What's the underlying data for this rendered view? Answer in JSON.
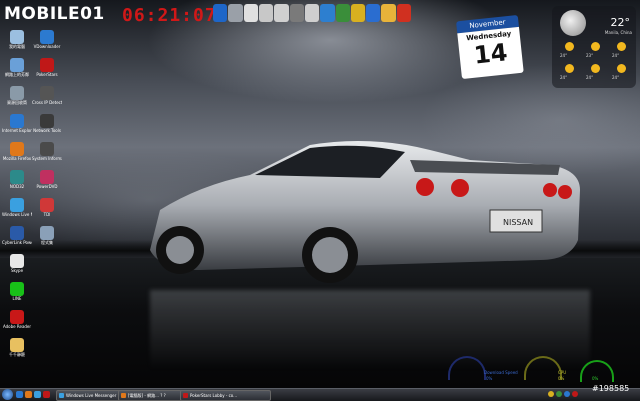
{
  "topbar": {
    "logo_text": "MOBILE01",
    "clock_time": "06:21:07",
    "launcher_colors": [
      "#1e66c8",
      "#9aa0a8",
      "#e0e0e0",
      "#c8c8c8",
      "#d0d0d0",
      "#7a7a7a",
      "#cfcfcf",
      "#2d7fd0",
      "#3a8e3a",
      "#d8b020",
      "#2a6dd0",
      "#e8b33a",
      "#d03020"
    ]
  },
  "calendar": {
    "month": "November",
    "weekday": "Wednesday",
    "day": "14"
  },
  "weather": {
    "temp": "22°",
    "location": "Manila, China",
    "forecast_temps": [
      "24°",
      "23°",
      "24°",
      "24°",
      "24°",
      "24°"
    ]
  },
  "desktop_icons": [
    {
      "name": "icon-my-computer",
      "label": "我的電腦",
      "color": "#9bbfe0",
      "col": 0,
      "row": 0
    },
    {
      "name": "icon-vdownloader",
      "label": "VDownloader",
      "color": "#2c7ad0",
      "col": 1,
      "row": 0
    },
    {
      "name": "icon-network",
      "label": "網路上的芳鄰",
      "color": "#6aa0d8",
      "col": 0,
      "row": 1
    },
    {
      "name": "icon-pokerstars",
      "label": "PokerStars",
      "color": "#c01818",
      "col": 1,
      "row": 1
    },
    {
      "name": "icon-recycle-bin",
      "label": "資源回收筒",
      "color": "#8a9aa8",
      "col": 0,
      "row": 2
    },
    {
      "name": "icon-cross-ip",
      "label": "Cross IP Detect",
      "color": "#555",
      "col": 1,
      "row": 2
    },
    {
      "name": "icon-ie",
      "label": "Internet Explorer",
      "color": "#2a78d0",
      "col": 0,
      "row": 3
    },
    {
      "name": "icon-network-tools",
      "label": "Network Tools",
      "color": "#3a3a3a",
      "col": 1,
      "row": 3
    },
    {
      "name": "icon-firefox",
      "label": "Mozilla Firefox",
      "color": "#e0781a",
      "col": 0,
      "row": 4
    },
    {
      "name": "icon-system",
      "label": "System Information",
      "color": "#4a4a4a",
      "col": 1,
      "row": 4
    },
    {
      "name": "icon-nod32",
      "label": "NOD32",
      "color": "#2c8a8a",
      "col": 0,
      "row": 5
    },
    {
      "name": "icon-powerdvd",
      "label": "PowerDVD",
      "color": "#c03060",
      "col": 1,
      "row": 5
    },
    {
      "name": "icon-live-messenger",
      "label": "Windows Live Messenger",
      "color": "#3aa0e0",
      "col": 0,
      "row": 6
    },
    {
      "name": "icon-tdi",
      "label": "TDI",
      "color": "#d03838",
      "col": 1,
      "row": 6
    },
    {
      "name": "icon-cyberlink",
      "label": "CyberLink PowerDVD",
      "color": "#2a5aa8",
      "col": 0,
      "row": 7
    },
    {
      "name": "icon-program",
      "label": "程式集",
      "color": "#8aa0b8",
      "col": 1,
      "row": 7
    },
    {
      "name": "icon-skype",
      "label": "Skype",
      "color": "#e8e8e8",
      "col": 0,
      "row": 8
    },
    {
      "name": "icon-line",
      "label": "LINE",
      "color": "#18c018",
      "col": 0,
      "row": 9
    },
    {
      "name": "icon-adobe-reader",
      "label": "Adobe Reader",
      "color": "#c81818",
      "col": 0,
      "row": 10
    },
    {
      "name": "icon-qq",
      "label": "千千靜聽",
      "color": "#e8c060",
      "col": 0,
      "row": 11
    }
  ],
  "gadgets": {
    "download_label": "Download Speed",
    "download_value": "0%",
    "cpu_label": "CPU",
    "cpu_value": "0%",
    "ram_value": "0%"
  },
  "taskbar": {
    "quick_colors": [
      "#2a78d0",
      "#e0781a",
      "#3aa0e0",
      "#c01818"
    ],
    "tasks": [
      {
        "label": "Windows Live Messenger",
        "color": "#3aa0e0"
      },
      {
        "label": "[電腦版] - 網路... ? ?",
        "color": "#e0781a"
      },
      {
        "label": "PokerStars Lobby - co...",
        "color": "#c01818"
      }
    ],
    "tray_colors": [
      "#d8b020",
      "#3a8e3a",
      "#2a78d0",
      "#c01818"
    ]
  },
  "watermark": "#198585"
}
